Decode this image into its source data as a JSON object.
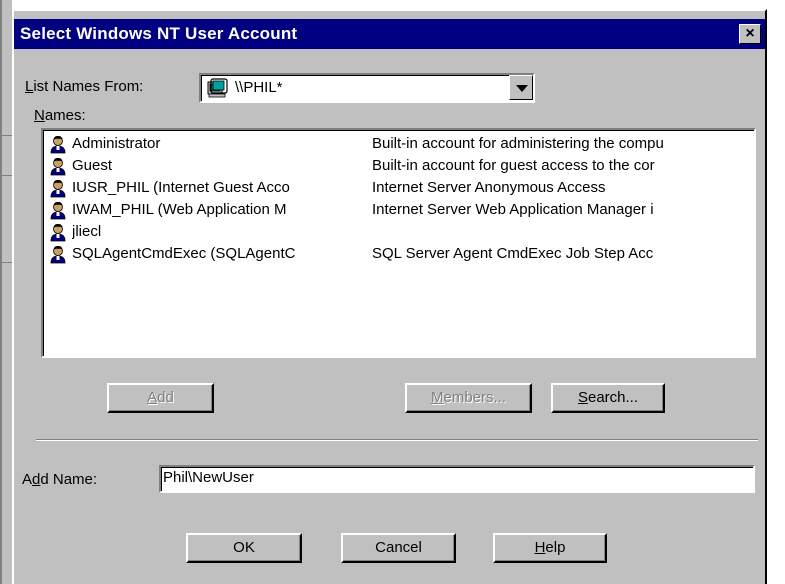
{
  "dialog": {
    "title": "Select Windows NT User Account",
    "close_glyph": "×"
  },
  "list_from": {
    "label_key": "L",
    "label_rest": "ist Names From:",
    "value": "\\\\PHIL*",
    "icon": "computer-icon"
  },
  "names": {
    "label_key": "N",
    "label_rest": "ames:",
    "icon": "user-icon",
    "items": [
      {
        "name": "Administrator",
        "description": "Built-in account for administering the compu"
      },
      {
        "name": "Guest",
        "description": "Built-in account for guest access to the cor"
      },
      {
        "name": "IUSR_PHIL (Internet Guest Acco",
        "description": "Internet Server Anonymous Access"
      },
      {
        "name": "IWAM_PHIL (Web Application M",
        "description": "Internet Server Web Application Manager i"
      },
      {
        "name": "jliecl",
        "description": ""
      },
      {
        "name": "SQLAgentCmdExec (SQLAgentC",
        "description": "SQL Server Agent CmdExec Job Step Acc"
      }
    ]
  },
  "buttons": {
    "add_key": "A",
    "add_rest": "dd",
    "members_key": "M",
    "members_rest": "embers...",
    "search_key": "S",
    "search_rest": "earch...",
    "ok": "OK",
    "cancel": "Cancel",
    "help_key": "H",
    "help_rest": "elp"
  },
  "add_name": {
    "label_pre": "A",
    "label_key": "d",
    "label_rest": "d Name:",
    "value": "Phil\\NewUser"
  },
  "colors": {
    "titlebar": "#000080",
    "face": "#c0c0c0"
  }
}
